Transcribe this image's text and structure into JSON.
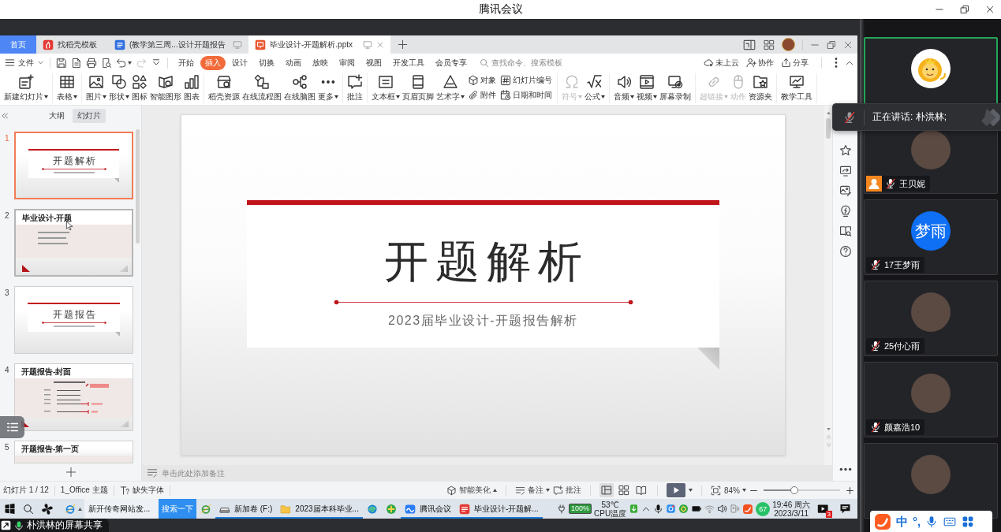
{
  "meeting": {
    "title": "腾讯会议"
  },
  "wps": {
    "tabs": [
      {
        "kind": "home",
        "label": "首页",
        "selected": false
      },
      {
        "kind": "docer",
        "label": "找稻壳模板",
        "selected": false
      },
      {
        "kind": "writer",
        "label": "(教学第三周...设计开题报告",
        "selected": false
      },
      {
        "kind": "presentation",
        "label": "毕业设计-开题解析.pptx",
        "selected": true
      }
    ],
    "menu": {
      "file": "文件",
      "quick_tools": [
        {
          "kind": "save",
          "disabled": false
        },
        {
          "kind": "pdf",
          "disabled": false
        },
        {
          "kind": "print",
          "disabled": false
        },
        {
          "kind": "preview",
          "disabled": false
        },
        {
          "kind": "undo",
          "disabled": false
        },
        {
          "kind": "redo",
          "disabled": true
        },
        {
          "kind": "customize",
          "disabled": false
        }
      ],
      "tabs": [
        {
          "label": "开始",
          "selected": false
        },
        {
          "label": "插入",
          "selected": true
        },
        {
          "label": "设计",
          "selected": false
        },
        {
          "label": "切换",
          "selected": false
        },
        {
          "label": "动画",
          "selected": false
        },
        {
          "label": "放映",
          "selected": false
        },
        {
          "label": "审阅",
          "selected": false
        },
        {
          "label": "视图",
          "selected": false
        },
        {
          "label": "开发工具",
          "selected": false
        },
        {
          "label": "会员专享",
          "selected": false
        }
      ],
      "search": {
        "placeholder": "查找命令、搜索模板"
      },
      "actions": [
        {
          "kind": "cloud",
          "label": "未上云"
        },
        {
          "kind": "collab",
          "label": "协作"
        },
        {
          "kind": "share",
          "label": "分享"
        }
      ]
    },
    "ribbon": [
      {
        "items": [
          {
            "kind": "newslide",
            "label": "新建幻灯片",
            "dropdown": true,
            "disabled": false
          }
        ]
      },
      {
        "items": [
          {
            "kind": "table",
            "label": "表格",
            "dropdown": true,
            "disabled": false
          }
        ]
      },
      {
        "items": [
          {
            "kind": "picture",
            "label": "图片",
            "dropdown": true,
            "disabled": false
          },
          {
            "kind": "shape",
            "label": "形状",
            "dropdown": true,
            "disabled": false
          },
          {
            "kind": "iconlib",
            "label": "图标",
            "dropdown": false,
            "disabled": false
          },
          {
            "kind": "smartart",
            "label": "智能图形",
            "dropdown": false,
            "disabled": false
          },
          {
            "kind": "chart",
            "label": "图表",
            "dropdown": false,
            "disabled": false
          }
        ]
      },
      {
        "items": [
          {
            "kind": "docer",
            "label": "稻壳资源",
            "dropdown": false,
            "disabled": false
          },
          {
            "kind": "flowchart",
            "label": "在线流程图",
            "dropdown": false,
            "disabled": false
          },
          {
            "kind": "mindmap",
            "label": "在线脑图",
            "dropdown": false,
            "disabled": false
          },
          {
            "kind": "more",
            "label": "更多",
            "dropdown": true,
            "disabled": false
          }
        ]
      },
      {
        "items": [
          {
            "kind": "comment",
            "label": "批注",
            "dropdown": false,
            "disabled": false
          }
        ]
      },
      {
        "items": [
          {
            "kind": "textbox",
            "label": "文本框",
            "dropdown": true,
            "disabled": false
          },
          {
            "kind": "headerfooter",
            "label": "页眉页脚",
            "dropdown": false,
            "disabled": false
          },
          {
            "kind": "wordart",
            "label": "艺术字",
            "dropdown": true,
            "disabled": false
          },
          {
            "kind": "stack",
            "rows": [
              {
                "kind": "object",
                "label": "对象"
              },
              {
                "kind": "attach",
                "label": "附件"
              }
            ]
          },
          {
            "kind": "stack",
            "rows": [
              {
                "kind": "slidenumber",
                "label": "幻灯片编号"
              },
              {
                "kind": "datetime",
                "label": "日期和时间"
              }
            ]
          }
        ]
      },
      {
        "items": [
          {
            "kind": "symbol",
            "label": "符号",
            "dropdown": true,
            "disabled": true
          },
          {
            "kind": "formula",
            "label": "公式",
            "dropdown": true,
            "disabled": false
          }
        ]
      },
      {
        "items": [
          {
            "kind": "audio",
            "label": "音频",
            "dropdown": true,
            "disabled": false
          },
          {
            "kind": "video",
            "label": "视频",
            "dropdown": true,
            "disabled": false
          },
          {
            "kind": "record",
            "label": "屏幕录制",
            "dropdown": false,
            "disabled": false
          }
        ]
      },
      {
        "items": [
          {
            "kind": "link",
            "label": "超链接",
            "dropdown": true,
            "disabled": true
          },
          {
            "kind": "action",
            "label": "动作",
            "dropdown": false,
            "disabled": true
          },
          {
            "kind": "folder",
            "label": "资源夹",
            "dropdown": false,
            "disabled": false
          }
        ]
      },
      {
        "items": [
          {
            "kind": "teach",
            "label": "教学工具",
            "dropdown": false,
            "disabled": false
          }
        ]
      }
    ],
    "slide_panel": {
      "tabs": [
        {
          "label": "大纲",
          "selected": false
        },
        {
          "label": "幻灯片",
          "selected": true
        }
      ],
      "slides": [
        {
          "number": "1",
          "kind": "cover",
          "title": "开题解析",
          "selected": true,
          "hover": false
        },
        {
          "number": "2",
          "kind": "content",
          "title": "毕业设计-开题",
          "selected": false,
          "hover": true
        },
        {
          "number": "3",
          "kind": "cover",
          "title": "开题报告",
          "selected": false,
          "hover": false
        },
        {
          "number": "4",
          "kind": "form",
          "title": "开题报告-封面",
          "selected": false,
          "hover": false
        },
        {
          "number": "5",
          "kind": "content",
          "title": "开题报告-第一页",
          "selected": false,
          "hover": false
        }
      ]
    },
    "slide": {
      "title": "开题解析",
      "subtitle": "2023届毕业设计-开题报告解析"
    },
    "notes": {
      "placeholder": "单击此处添加备注"
    },
    "status_bar": {
      "slide_count": "幻灯片 1 / 12",
      "theme": "1_Office 主题",
      "missing_fonts": "缺失字体",
      "beautify": "智能美化",
      "notes": "备注",
      "comments": "批注",
      "views": [
        {
          "kind": "normal",
          "selected": true
        },
        {
          "kind": "sorter",
          "selected": false
        },
        {
          "kind": "reading",
          "selected": false
        }
      ],
      "zoom": "84%",
      "zoom_slider": {
        "level": 0.4
      }
    }
  },
  "taskbar": {
    "search_band": {
      "value": "新开传奇网站发...",
      "button": "搜索一下"
    },
    "apps": [
      {
        "kind": "browser",
        "running": false
      },
      {
        "kind": "drive",
        "label": "新加卷 (F:)",
        "running": true
      },
      {
        "kind": "folder",
        "label": "2023届本科毕业...",
        "running": true
      },
      {
        "kind": "edge",
        "running": false
      },
      {
        "kind": "security",
        "running": false
      },
      {
        "kind": "meeting",
        "label": "腾讯会议",
        "running": true
      },
      {
        "kind": "office",
        "label": "毕业设计-开题解...",
        "running": true
      }
    ],
    "tray": {
      "battery": "100%",
      "temperature": "53℃",
      "temperature_label": "CPU温度",
      "score": "67",
      "time": "19:46 周六",
      "date": "2023/3/11",
      "badge": "3"
    }
  },
  "share_indicator": {
    "label": "朴洪林的屏幕共享"
  },
  "participants": [
    {
      "kind": "lion",
      "active": true
    },
    {
      "kind": "photo",
      "name": "王贝妮",
      "host": true,
      "muted": true,
      "active": false
    },
    {
      "kind": "initials",
      "initials": "梦雨",
      "name": "17王梦雨",
      "host": false,
      "muted": true,
      "active": false
    },
    {
      "kind": "photo",
      "name": "25付心雨",
      "host": false,
      "muted": true,
      "active": false
    },
    {
      "kind": "photo",
      "name": "颜嘉浩10",
      "host": false,
      "muted": true,
      "active": false
    },
    {
      "kind": "photo",
      "active": false
    }
  ],
  "speaking_toast": {
    "text": "正在讲话: 朴洪林;"
  },
  "ime_bar": {
    "mode": "中",
    "punctuation": "°,"
  }
}
